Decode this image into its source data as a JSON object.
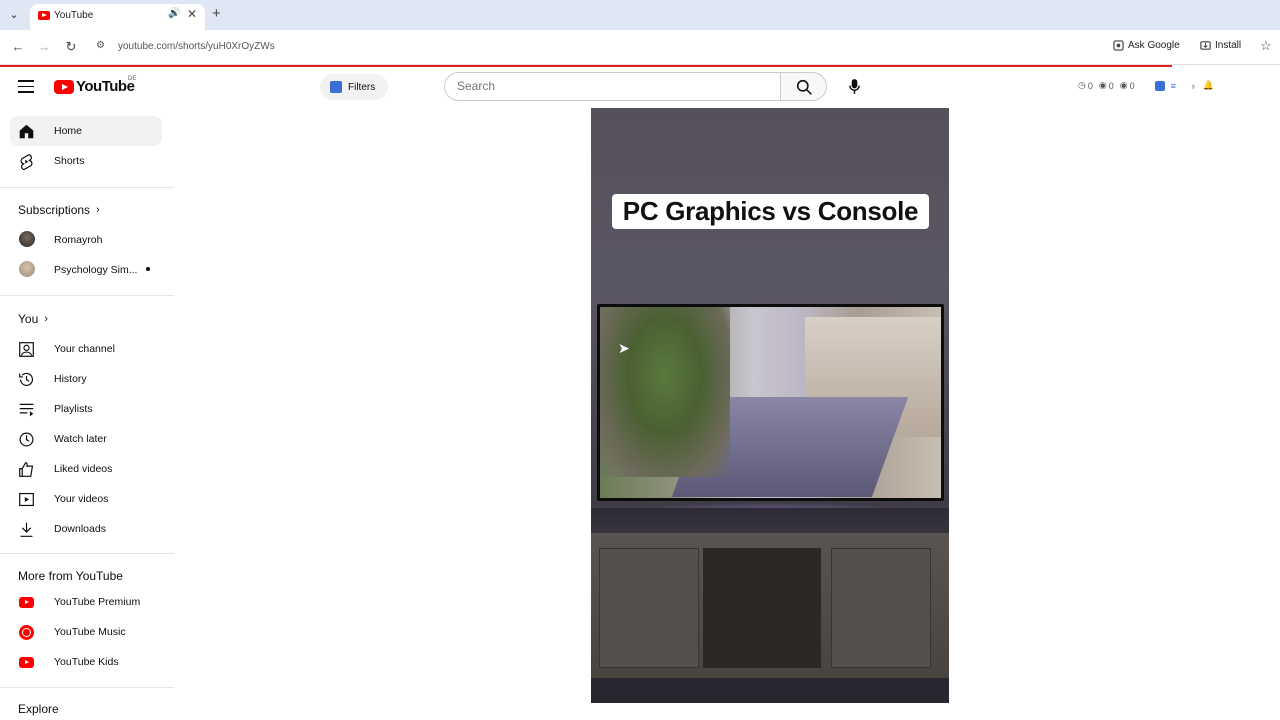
{
  "browser": {
    "tab": {
      "title": "YouTube"
    },
    "url": "youtube.com/shorts/yuH0XrOyZWs",
    "ask_google": "Ask Google",
    "install": "Install"
  },
  "header": {
    "logo_text": "YouTube",
    "country": "DE",
    "filters": "Filters",
    "search": {
      "placeholder": "Search",
      "value": ""
    },
    "ext_counts": [
      "0",
      "0",
      "0"
    ]
  },
  "sidebar": {
    "main": [
      {
        "label": "Home",
        "icon": "home-icon"
      },
      {
        "label": "Shorts",
        "icon": "shorts-icon"
      }
    ],
    "subscriptions_title": "Subscriptions",
    "subscriptions": [
      {
        "label": "Romayroh"
      },
      {
        "label": "Psychology Sim..."
      }
    ],
    "you_title": "You",
    "you": [
      {
        "label": "Your channel",
        "icon": "channel-icon"
      },
      {
        "label": "History",
        "icon": "history-icon"
      },
      {
        "label": "Playlists",
        "icon": "playlists-icon"
      },
      {
        "label": "Watch later",
        "icon": "watch-later-icon"
      },
      {
        "label": "Liked videos",
        "icon": "thumbs-up-icon"
      },
      {
        "label": "Your videos",
        "icon": "your-videos-icon"
      },
      {
        "label": "Downloads",
        "icon": "download-icon"
      }
    ],
    "more_title": "More from YouTube",
    "more": [
      {
        "label": "YouTube Premium"
      },
      {
        "label": "YouTube Music"
      },
      {
        "label": "YouTube Kids"
      }
    ],
    "explore_title": "Explore"
  },
  "video": {
    "caption": "PC Graphics vs Console"
  },
  "colors": {
    "brand_red": "#ff0000",
    "progress": "#e62117",
    "tabbar": "#dfe7f5"
  }
}
